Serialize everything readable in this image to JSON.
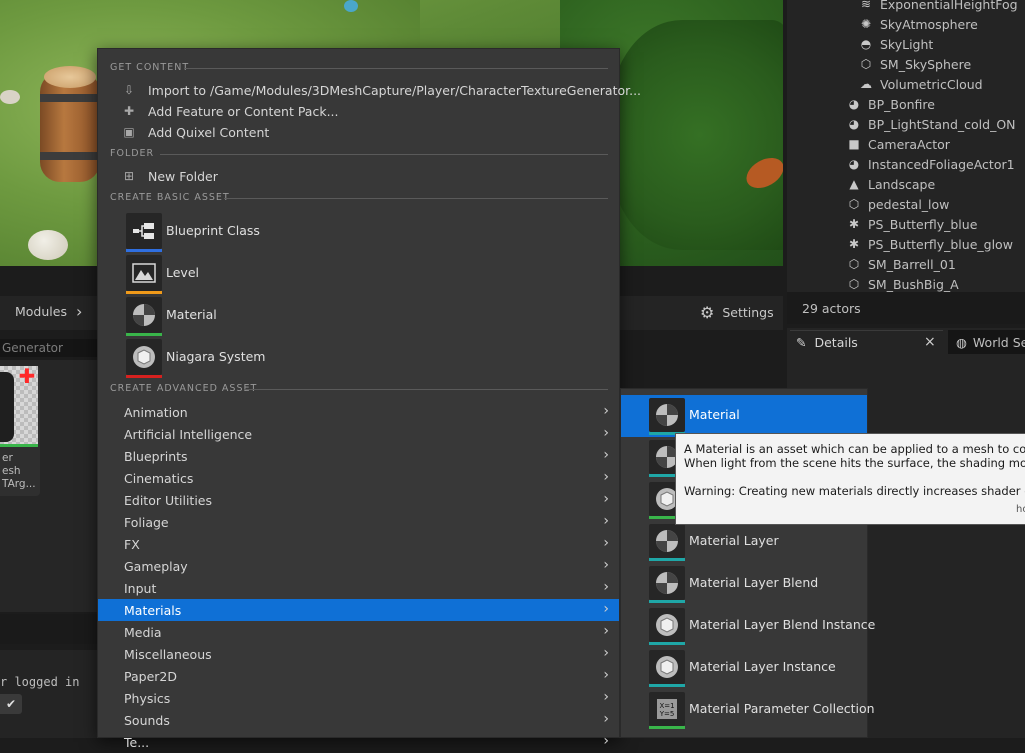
{
  "outliner": {
    "items": [
      {
        "label": "ExponentialHeightFog",
        "icon": "fog-icon",
        "glyph": "≋",
        "indent": 1
      },
      {
        "label": "SkyAtmosphere",
        "icon": "sky-atmosphere-icon",
        "glyph": "✺",
        "indent": 1
      },
      {
        "label": "SkyLight",
        "icon": "skylight-icon",
        "glyph": "◓",
        "indent": 1
      },
      {
        "label": "SM_SkySphere",
        "icon": "mesh-icon",
        "glyph": "⬡",
        "indent": 1
      },
      {
        "label": "VolumetricCloud",
        "icon": "cloud-icon",
        "glyph": "☁",
        "indent": 1
      },
      {
        "label": "BP_Bonfire",
        "icon": "blueprint-actor-icon",
        "glyph": "◕",
        "indent": 0
      },
      {
        "label": "BP_LightStand_cold_ON",
        "icon": "blueprint-actor-icon",
        "glyph": "◕",
        "indent": 0
      },
      {
        "label": "CameraActor",
        "icon": "camera-icon",
        "glyph": "■",
        "indent": 0
      },
      {
        "label": "InstancedFoliageActor1",
        "icon": "foliage-actor-icon",
        "glyph": "◕",
        "indent": 0
      },
      {
        "label": "Landscape",
        "icon": "landscape-icon",
        "glyph": "▲",
        "indent": 0
      },
      {
        "label": "pedestal_low",
        "icon": "mesh-icon",
        "glyph": "⬡",
        "indent": 0
      },
      {
        "label": "PS_Butterfly_blue",
        "icon": "particle-icon",
        "glyph": "✱",
        "indent": 0
      },
      {
        "label": "PS_Butterfly_blue_glow",
        "icon": "particle-icon",
        "glyph": "✱",
        "indent": 0
      },
      {
        "label": "SM_Barrell_01",
        "icon": "mesh-icon",
        "glyph": "⬡",
        "indent": 0
      },
      {
        "label": "SM_BushBig_A",
        "icon": "mesh-icon",
        "glyph": "⬡",
        "indent": 0
      }
    ],
    "actor_count": "29 actors"
  },
  "details": {
    "tab_label": "Details",
    "close_glyph": "×",
    "world_tab_label": "World Se"
  },
  "content_browser": {
    "breadcrumb": "Modules",
    "settings_label": "Settings",
    "path_text": "Generator",
    "asset_label_lines": [
      "er",
      "esh",
      "TArg..."
    ],
    "logged_text": "r logged in",
    "check_glyph": "✔"
  },
  "menu": {
    "get_content_header": "GET CONTENT",
    "get_content": [
      {
        "label": "Import to /Game/Modules/3DMeshCapture/Player/CharacterTextureGenerator...",
        "icon": "import-icon",
        "glyph": "⇩"
      },
      {
        "label": "Add Feature or Content Pack...",
        "icon": "content-pack-icon",
        "glyph": "✚"
      },
      {
        "label": "Add Quixel Content",
        "icon": "quixel-icon",
        "glyph": "▣"
      }
    ],
    "folder_header": "FOLDER",
    "new_folder_label": "New Folder",
    "basic_header": "CREATE BASIC ASSET",
    "basic": [
      {
        "label": "Blueprint Class",
        "icon": "blueprint-class-icon",
        "color": "#2f6fe0"
      },
      {
        "label": "Level",
        "icon": "level-icon",
        "color": "#f09a1a"
      },
      {
        "label": "Material",
        "icon": "material-icon",
        "color": "#39b54a"
      },
      {
        "label": "Niagara System",
        "icon": "niagara-icon",
        "color": "#d6211f"
      }
    ],
    "advanced_header": "CREATE ADVANCED ASSET",
    "advanced": [
      {
        "label": "Animation"
      },
      {
        "label": "Artificial Intelligence"
      },
      {
        "label": "Blueprints"
      },
      {
        "label": "Cinematics"
      },
      {
        "label": "Editor Utilities"
      },
      {
        "label": "Foliage"
      },
      {
        "label": "FX"
      },
      {
        "label": "Gameplay"
      },
      {
        "label": "Input"
      },
      {
        "label": "Materials",
        "selected": true
      },
      {
        "label": "Media"
      },
      {
        "label": "Miscellaneous"
      },
      {
        "label": "Paper2D"
      },
      {
        "label": "Physics"
      },
      {
        "label": "Sounds"
      },
      {
        "label": "Te..."
      }
    ]
  },
  "submenu": {
    "items": [
      {
        "label": "Material",
        "icon": "material-icon",
        "selected": true
      },
      {
        "label": "",
        "icon": "material-function-icon"
      },
      {
        "label": "",
        "icon": "material-instance-icon"
      },
      {
        "label": "Material Layer",
        "icon": "material-layer-icon"
      },
      {
        "label": "Material Layer Blend",
        "icon": "material-layer-blend-icon"
      },
      {
        "label": "Material Layer Blend Instance",
        "icon": "material-layer-blend-instance-icon"
      },
      {
        "label": "Material Layer Instance",
        "icon": "material-layer-instance-icon"
      },
      {
        "label": "Material Parameter Collection",
        "icon": "parameter-collection-icon"
      }
    ]
  },
  "tooltip": {
    "line1": "A Material is an asset which can be applied to a mesh to contro",
    "line2": "When light from the scene hits the surface, the shading model o",
    "warning": "Warning: Creating new materials directly increases shader comp",
    "hint": "ho"
  },
  "colors": {
    "selection": "#0f70d6",
    "menu_bg": "#383838",
    "panel_bg": "#242424"
  }
}
